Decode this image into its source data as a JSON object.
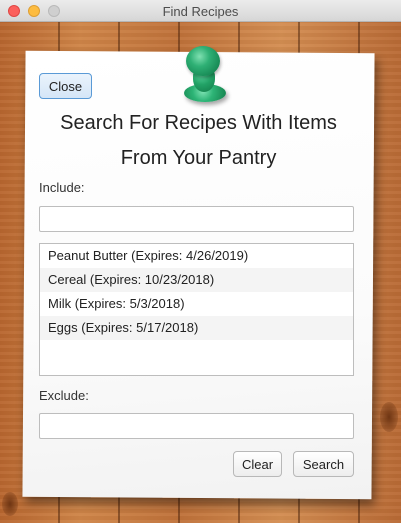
{
  "window": {
    "title": "Find Recipes"
  },
  "header": {
    "close_label": "Close",
    "title_line1": "Search For Recipes With Items",
    "title_line2": "From Your Pantry"
  },
  "include": {
    "label": "Include:",
    "value": "",
    "items": [
      "Peanut Butter (Expires: 4/26/2019)",
      "Cereal (Expires: 10/23/2018)",
      "Milk (Expires: 5/3/2018)",
      "Eggs (Expires: 5/17/2018)"
    ]
  },
  "exclude": {
    "label": "Exclude:",
    "value": ""
  },
  "actions": {
    "clear_label": "Clear",
    "search_label": "Search"
  },
  "colors": {
    "pin": "#22a266",
    "focus_border": "#5a9ad6"
  }
}
